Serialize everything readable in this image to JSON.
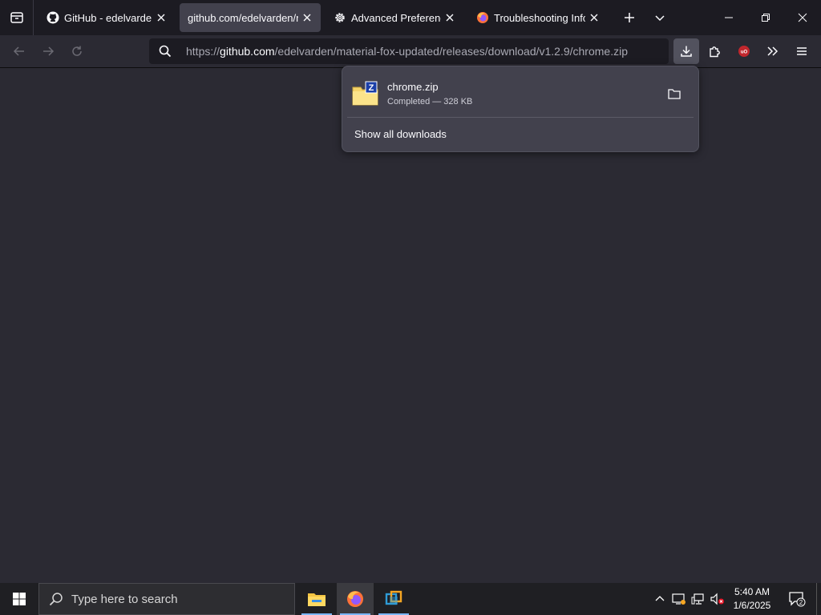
{
  "tabs": [
    {
      "title": "GitHub - edelvarden/material-fox-updated",
      "icon": "github-icon",
      "active": false
    },
    {
      "title": "github.com/edelvarden/material-fox-updated",
      "icon": null,
      "active": true
    },
    {
      "title": "Advanced Preferences",
      "icon": "gear-icon",
      "active": false
    },
    {
      "title": "Troubleshooting Information",
      "icon": "firefox-icon",
      "active": false
    }
  ],
  "url": {
    "scheme": "https://",
    "host": "github.com",
    "path": "/edelvarden/material-fox-updated/releases/download/v1.2.9/chrome.zip"
  },
  "downloads": {
    "items": [
      {
        "filename": "chrome.zip",
        "status": "Completed — 328 KB",
        "icon": "zip-archive-icon"
      }
    ],
    "show_all_label": "Show all downloads"
  },
  "taskbar": {
    "search_placeholder": "Type here to search",
    "apps": [
      "file-explorer-icon",
      "firefox-icon",
      "virtualbox-icon"
    ],
    "time": "5:40 AM",
    "date": "1/6/2025",
    "notification_count": "2"
  },
  "colors": {
    "toolbar_bg": "#2b2a33",
    "tabbar_bg": "#1c1b22",
    "active_tab": "#42414d",
    "panel_bg": "#42414d",
    "ublock": "#c1272d",
    "taskbar_bg": "#1f1f23"
  }
}
